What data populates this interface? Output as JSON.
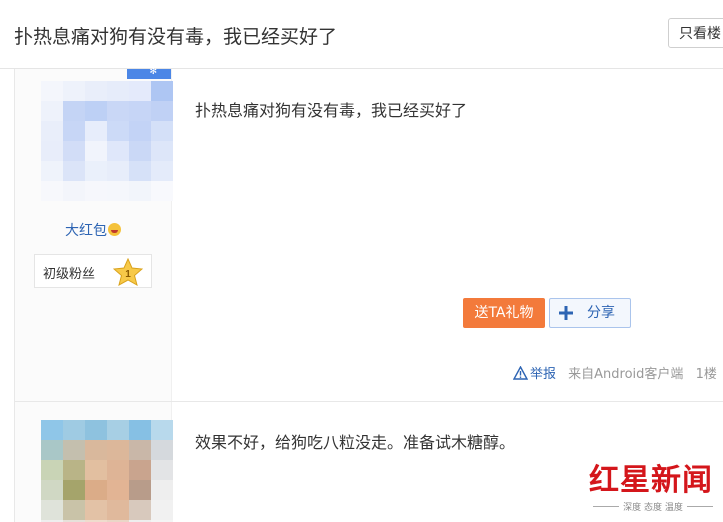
{
  "header": {
    "thread_title": "扑热息痛对狗有没有毒，我已经买好了",
    "only_op_label": "只看楼"
  },
  "posts": [
    {
      "username": "大红包",
      "fan_level_label": "初级粉丝",
      "fan_level_number": "1",
      "text": "扑热息痛对狗有没有毒，我已经买好了",
      "gift_label": "送TA礼物",
      "share_label": "分享",
      "report_label": "举报",
      "source_label": "来自Android客户端",
      "floor_label": "1楼"
    },
    {
      "text": "效果不好，给狗吃八粒没走。准备试木糖醇。"
    }
  ],
  "watermark": {
    "logo_text": "红星新闻",
    "slogan": "深度 态度 温度"
  },
  "colors": {
    "link_blue": "#2d64b3",
    "gift_orange": "#f37a3b",
    "watermark_red": "#d4161b"
  }
}
